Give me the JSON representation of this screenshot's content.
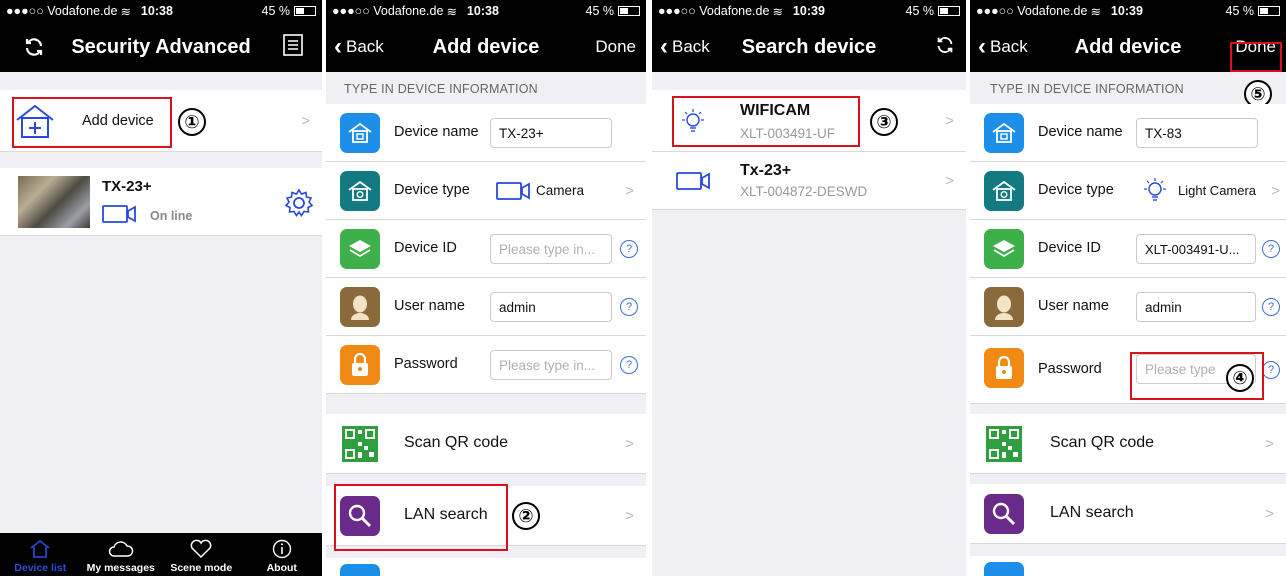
{
  "status": {
    "carrier": "●●●○○ Vodafone.de",
    "battery": "45 %",
    "times": [
      "10:38",
      "10:38",
      "10:39",
      "10:39"
    ]
  },
  "screen1": {
    "title": "Security Advanced",
    "add_device": "Add device",
    "device_name": "TX-23+",
    "device_status": "On line",
    "marker": "①",
    "tabs": [
      "Device list",
      "My messages",
      "Scene mode",
      "About"
    ]
  },
  "screen2": {
    "back": "Back",
    "title": "Add device",
    "done": "Done",
    "section": "TYPE IN DEVICE INFORMATION",
    "labels": {
      "name": "Device name",
      "type": "Device type",
      "id": "Device ID",
      "user": "User name",
      "password": "Password"
    },
    "values": {
      "name": "TX-23+",
      "type": "Camera",
      "user": "admin"
    },
    "placeholders": {
      "id": "Please type in...",
      "password": "Please type in..."
    },
    "help": "?",
    "scan_qr": "Scan QR code",
    "lan_search": "LAN search",
    "marker": "②"
  },
  "screen3": {
    "back": "Back",
    "title": "Search device",
    "results": [
      {
        "name": "WIFICAM",
        "id": "XLT-003491-UF"
      },
      {
        "name": "Tx-23+",
        "id": "XLT-004872-DESWD"
      }
    ],
    "marker": "③"
  },
  "screen4": {
    "back": "Back",
    "title": "Add device",
    "done": "Done",
    "section": "TYPE IN DEVICE INFORMATION",
    "labels": {
      "name": "Device name",
      "type": "Device type",
      "id": "Device ID",
      "user": "User name",
      "password": "Password"
    },
    "values": {
      "name": "TX-83",
      "type": "Light Camera",
      "id": "XLT-003491-U...",
      "user": "admin"
    },
    "placeholders": {
      "password": "Please type"
    },
    "help": "?",
    "scan_qr": "Scan QR code",
    "lan_search": "LAN search",
    "markers": [
      "④",
      "⑤"
    ]
  },
  "colors": {
    "highlight": "#d8121a",
    "accent_blue": "#2b4fd6",
    "icon_blue": "#1e8fe8",
    "icon_teal": "#147a82",
    "icon_green": "#3db04a",
    "icon_brown": "#8a6a3a",
    "icon_orange": "#f08a14",
    "icon_purple": "#6a2a8a"
  }
}
